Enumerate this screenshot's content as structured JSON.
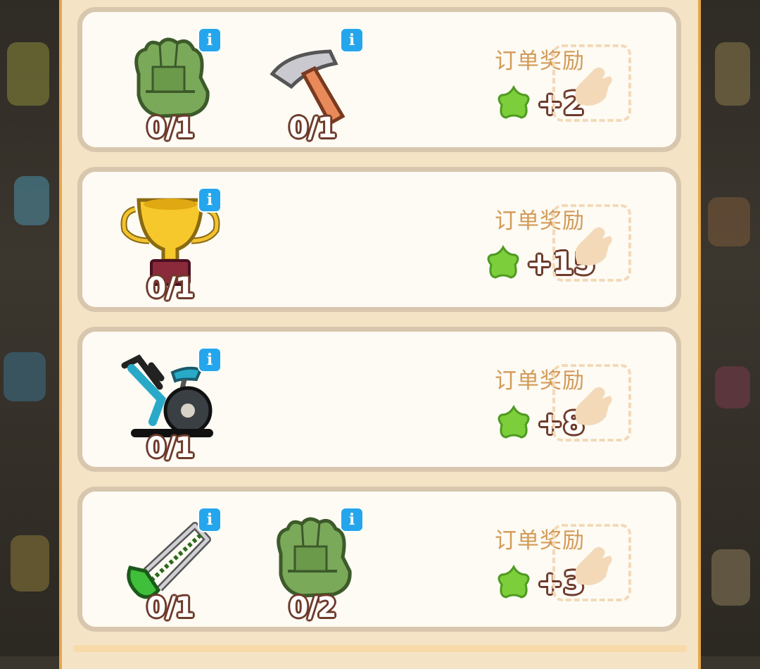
{
  "orders": [
    {
      "items": [
        {
          "icon": "gloves-icon",
          "count": "0/1"
        },
        {
          "icon": "hammer-icon",
          "count": "0/1"
        }
      ],
      "reward_title": "订单奖励",
      "reward_value": "+2"
    },
    {
      "items": [
        {
          "icon": "trophy-icon",
          "count": "0/1"
        }
      ],
      "reward_title": "订单奖励",
      "reward_value": "+15"
    },
    {
      "items": [
        {
          "icon": "exercise-bike-icon",
          "count": "0/1"
        }
      ],
      "reward_title": "订单奖励",
      "reward_value": "+8"
    },
    {
      "items": [
        {
          "icon": "hacksaw-icon",
          "count": "0/1"
        },
        {
          "icon": "gloves-icon",
          "count": "0/2"
        }
      ],
      "reward_title": "订单奖励",
      "reward_value": "+3"
    }
  ],
  "info_label": "i",
  "colors": {
    "reward_star": "#7ccf3a",
    "info_badge": "#25a6ec",
    "card_border": "#d8c7ae",
    "panel_edge": "#e7a64a"
  }
}
